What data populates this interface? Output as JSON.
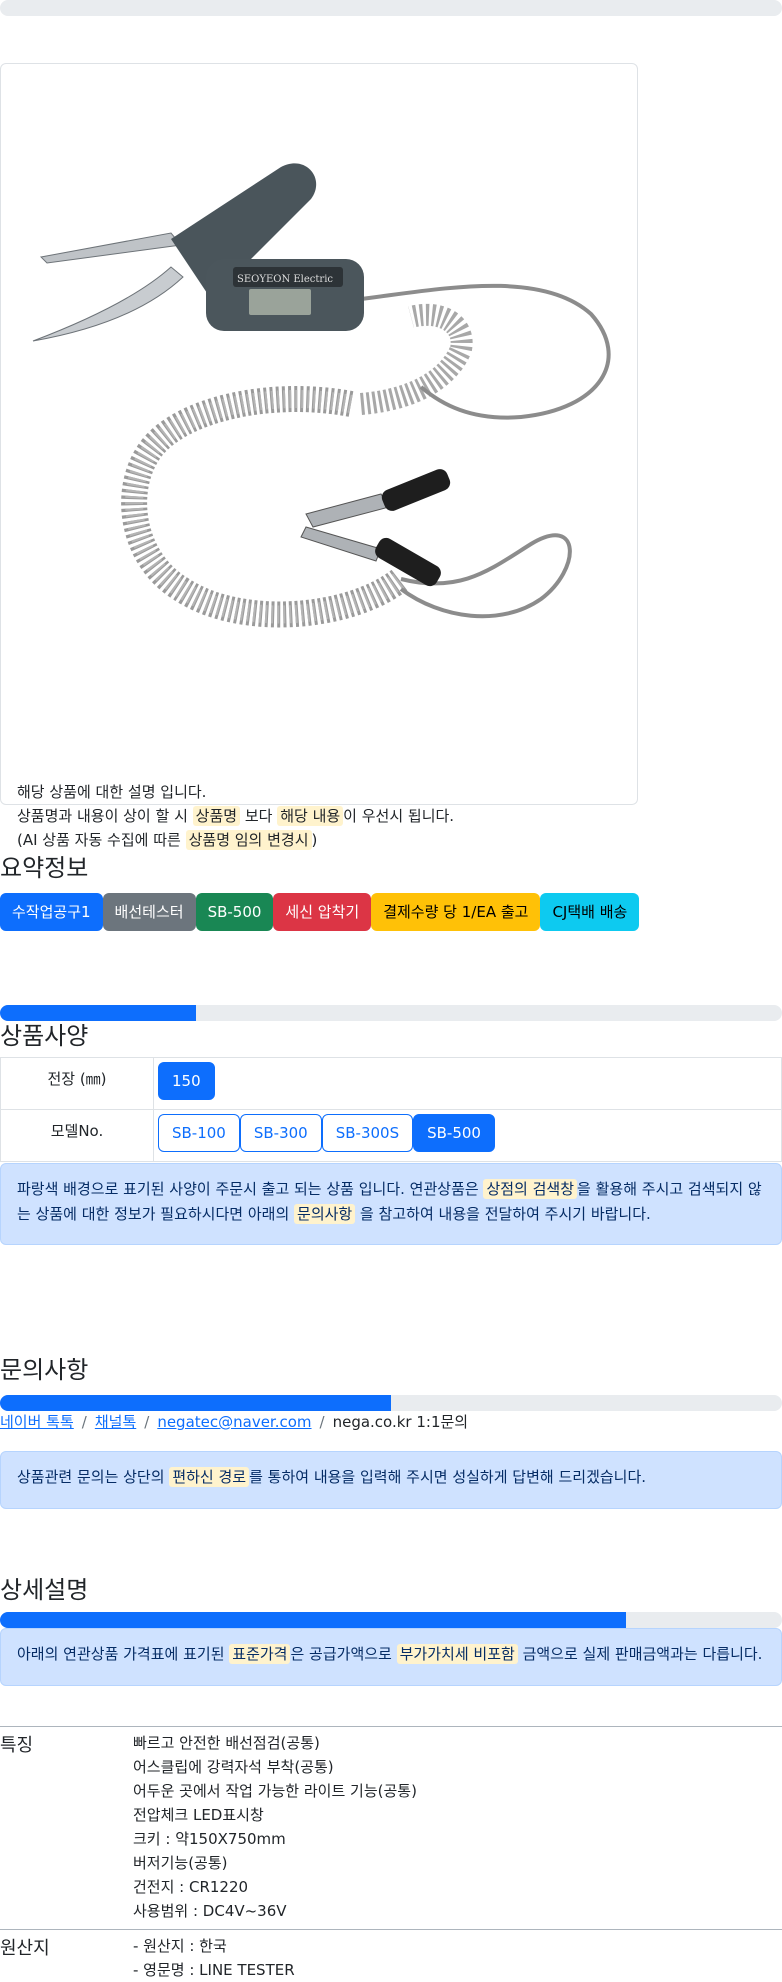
{
  "product": {
    "image_alt": "SEOYEON Electric wire tester",
    "description_lines": [
      {
        "parts": [
          {
            "t": "해당 상품에 대한 설명 입니다.",
            "hl": false
          }
        ]
      },
      {
        "parts": [
          {
            "t": "상품명과 내용이 상이 할 시 ",
            "hl": false
          },
          {
            "t": "상품명",
            "hl": true
          },
          {
            "t": " 보다 ",
            "hl": false
          },
          {
            "t": "해당 내용",
            "hl": true
          },
          {
            "t": "이 우선시 됩니다.",
            "hl": false
          }
        ]
      },
      {
        "parts": [
          {
            "t": "(AI 상품 자동 수집에 따른 ",
            "hl": false
          },
          {
            "t": "상품명 임의 변경시",
            "hl": true
          },
          {
            "t": ")",
            "hl": false
          }
        ]
      }
    ]
  },
  "summary": {
    "title": "요약정보",
    "badges": [
      {
        "label": "수작업공구1",
        "bg": "#0d6efd",
        "fg": "#ffffff"
      },
      {
        "label": "배선테스터",
        "bg": "#6c757d",
        "fg": "#ffffff"
      },
      {
        "label": "SB-500",
        "bg": "#198754",
        "fg": "#ffffff"
      },
      {
        "label": "세신 압착기",
        "bg": "#dc3545",
        "fg": "#ffffff"
      },
      {
        "label": "결제수량 당 1/EA 출고",
        "bg": "#ffc107",
        "fg": "#000000"
      },
      {
        "label": "CJ택배 배송",
        "bg": "#0dcaf0",
        "fg": "#000000"
      }
    ]
  },
  "specs": {
    "title": "상품사양",
    "progress": 0.25,
    "rows": [
      {
        "label": "전장 (㎜)",
        "options": [
          {
            "label": "150",
            "active": true
          }
        ]
      },
      {
        "label": "모델No.",
        "options": [
          {
            "label": "SB-100",
            "active": false
          },
          {
            "label": "SB-300",
            "active": false
          },
          {
            "label": "SB-300S",
            "active": false
          },
          {
            "label": "SB-500",
            "active": true
          }
        ]
      }
    ],
    "notice": [
      {
        "t": "파랑색 배경으로 표기된 사양이 주문시 출고 되는 상품 입니다. 연관상품은 ",
        "hl": false
      },
      {
        "t": "상점의 검색창",
        "hl": true
      },
      {
        "t": "을 활용해 주시고 검색되지 않는 상품에 대한 정보가 필요하시다면 아래의 ",
        "hl": false
      },
      {
        "t": "문의사항",
        "hl": true
      },
      {
        "t": " 을 참고하여 내용을 전달하여 주시기 바랍니다.",
        "hl": false
      }
    ]
  },
  "inquiry": {
    "title": "문의사항",
    "progress": 0.5,
    "links": [
      {
        "label": "네이버 톡톡",
        "link": true
      },
      {
        "label": "채널톡",
        "link": true
      },
      {
        "label": "negatec@naver.com",
        "link": true
      },
      {
        "label": "nega.co.kr 1:1문의",
        "link": false
      }
    ],
    "notice": [
      {
        "t": "상품관련 문의는 상단의 ",
        "hl": false
      },
      {
        "t": "편하신 경로",
        "hl": true
      },
      {
        "t": "를 통하여 내용을 입력해 주시면 성실하게 답변해 드리겠습니다.",
        "hl": false
      }
    ]
  },
  "detail": {
    "title": "상세설명",
    "progress": 0.8,
    "notice": [
      {
        "t": "아래의 연관상품 가격표에 표기된 ",
        "hl": false
      },
      {
        "t": "표준가격",
        "hl": true
      },
      {
        "t": "은 공급가액으로 ",
        "hl": false
      },
      {
        "t": "부가가치세 비포함",
        "hl": true
      },
      {
        "t": " 금액으로 실제 판매금액과는 다릅니다.",
        "hl": false
      }
    ],
    "features_label": "특징",
    "features": [
      "빠르고 안전한 배선점검(공통)",
      "어스클립에 강력자석 부착(공통)",
      "어두운 곳에서 작업 가능한 라이트 기능(공통)",
      "전압체크 LED표시창",
      "크키 : 약150X750mm",
      "버저기능(공통)",
      "건전지 : CR1220",
      "사용범위 : DC4V~36V"
    ],
    "origin_label": "원산지",
    "origin": [
      "- 원산지 : 한국",
      "- 영문명 : LINE TESTER"
    ]
  }
}
